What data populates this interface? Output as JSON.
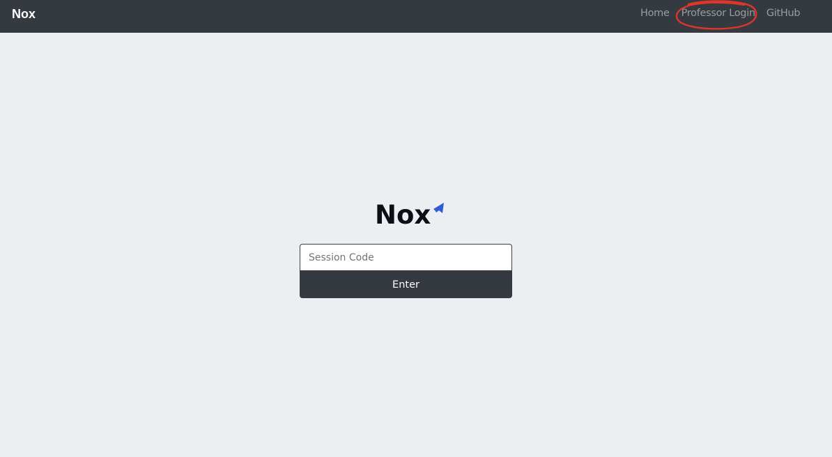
{
  "navbar": {
    "brand": "Nox",
    "links": [
      {
        "label": "Home"
      },
      {
        "label": "Professor Login"
      },
      {
        "label": "GitHub"
      }
    ],
    "background": "#343a40"
  },
  "logo": {
    "text": "Nox",
    "accent_color": "#2f5bd6"
  },
  "session_form": {
    "input_placeholder": "Session Code",
    "input_value": "",
    "button_label": "Enter"
  },
  "annotation": {
    "color": "#e0352b",
    "shape": "ellipse-around-professor-login"
  }
}
